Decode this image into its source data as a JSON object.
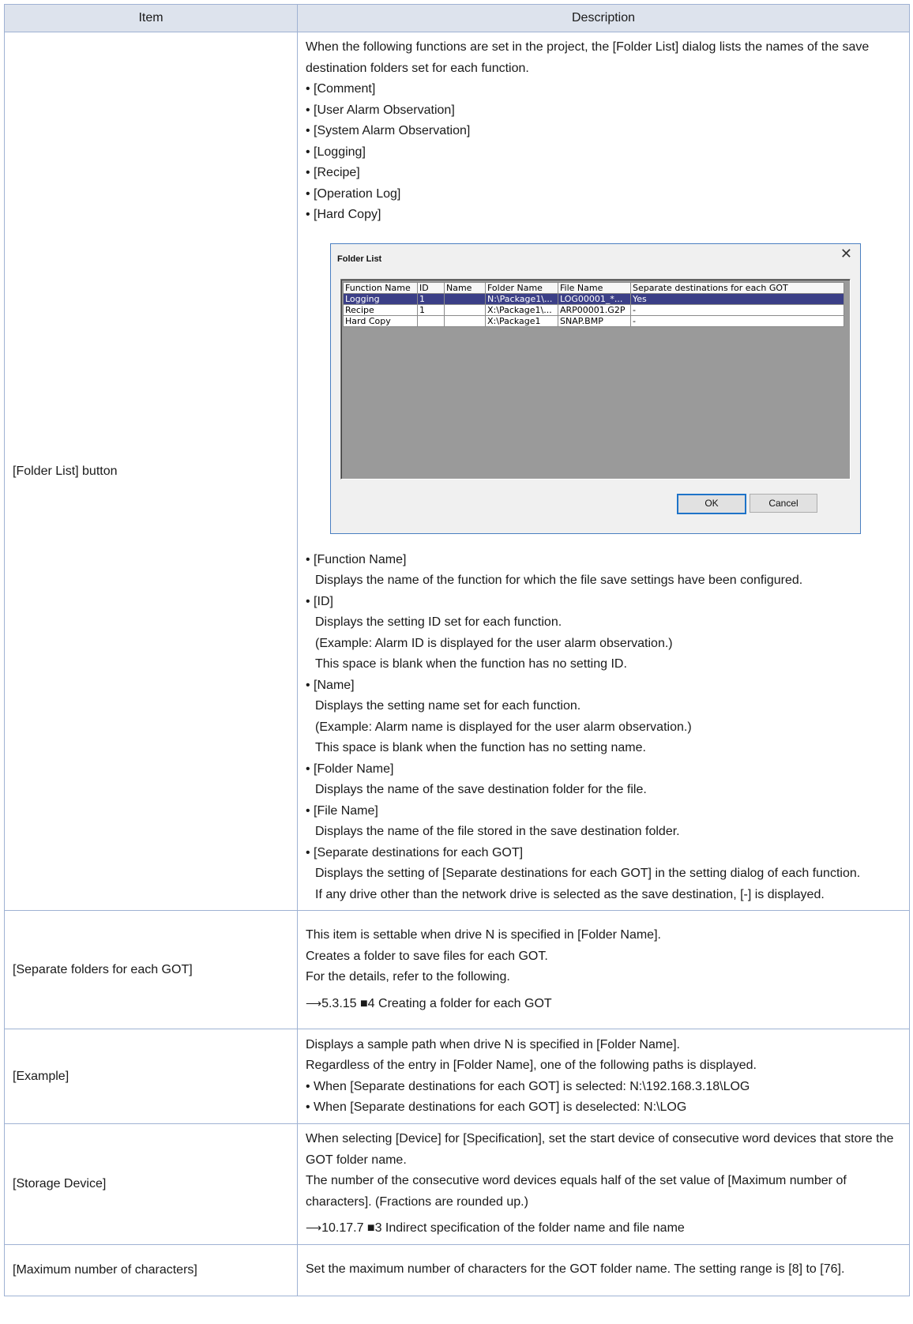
{
  "header": {
    "item": "Item",
    "description": "Description"
  },
  "rows": [
    {
      "item": "[Folder List] button",
      "intro": "When the following functions are set in the project, the [Folder List] dialog lists the names of the save destination folders set for each function.",
      "functions": [
        "• [Comment]",
        "• [User Alarm Observation]",
        "• [System Alarm Observation]",
        "• [Logging]",
        "• [Recipe]",
        "• [Operation Log]",
        "• [Hard Copy]"
      ],
      "fields": [
        {
          "name": "• [Function Name]",
          "lines": [
            "Displays the name of the function for which the file save settings have been configured."
          ]
        },
        {
          "name": "• [ID]",
          "lines": [
            "Displays the setting ID set for each function.",
            "(Example: Alarm ID is displayed for the user alarm observation.)",
            "This space is blank when the function has no setting ID."
          ]
        },
        {
          "name": "• [Name]",
          "lines": [
            "Displays the setting name set for each function.",
            "(Example: Alarm name is displayed for the user alarm observation.)",
            "This space is blank when the function has no setting name."
          ]
        },
        {
          "name": "• [Folder Name]",
          "lines": [
            "Displays the name of the save destination folder for the file."
          ]
        },
        {
          "name": "• [File Name]",
          "lines": [
            "Displays the name of the file stored in the save destination folder."
          ]
        },
        {
          "name": "• [Separate destinations for each GOT]",
          "lines": [
            "Displays the setting of [Separate destinations for each GOT] in the setting dialog of each function.",
            "If any drive other than the network drive is selected as the save destination, [-] is displayed."
          ]
        }
      ]
    },
    {
      "item": "[Separate folders for each GOT]",
      "lines": [
        "This item is settable when drive N is specified in [Folder Name].",
        "Creates a folder to save files for each GOT.",
        "For the details, refer to the following."
      ],
      "ref": "5.3.15 ■4 Creating a folder for each GOT"
    },
    {
      "item": "[Example]",
      "lines": [
        "Displays a sample path when drive N is specified in [Folder Name].",
        "Regardless of the entry in [Folder Name], one of the following paths is displayed.",
        "• When [Separate destinations for each GOT] is selected: N:\\192.168.3.18\\LOG",
        "• When [Separate destinations for each GOT] is deselected: N:\\LOG"
      ]
    },
    {
      "item": "[Storage Device]",
      "lines": [
        "When selecting [Device] for [Specification], set the start device of consecutive word devices that store the GOT folder name.",
        "The number of the consecutive word devices equals half of the set value of [Maximum number of characters]. (Fractions are rounded up.)"
      ],
      "ref": "10.17.7 ■3 Indirect specification of the folder name and file name"
    },
    {
      "item": "[Maximum number of characters]",
      "lines": [
        "Set the maximum number of characters for the GOT folder name. The setting range is [8] to [76]."
      ]
    }
  ],
  "dialog": {
    "title": "Folder List",
    "close_glyph": "✕",
    "columns": [
      "Function Name",
      "ID",
      "Name",
      "Folder Name",
      "File Name",
      "Separate destinations for each GOT"
    ],
    "rows": [
      [
        "Logging",
        "1",
        "",
        "N:\\Package1\\...",
        "LOG00001_*...",
        "Yes"
      ],
      [
        "Recipe",
        "1",
        "",
        "X:\\Package1\\...",
        "ARP00001.G2P",
        "-"
      ],
      [
        "Hard Copy",
        "",
        "",
        "X:\\Package1",
        "SNAP.BMP",
        "-"
      ]
    ],
    "ok_label": "OK",
    "cancel_label": "Cancel"
  }
}
